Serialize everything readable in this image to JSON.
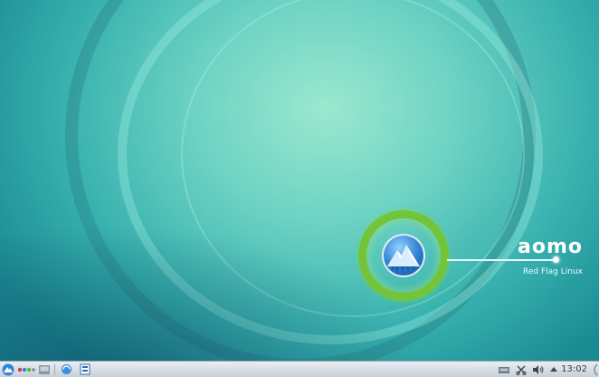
{
  "desktop": {
    "brand": {
      "name": "aomo",
      "subtitle": "Red Flag Linux"
    },
    "colors": {
      "ring_green": "#74c43a",
      "globe_blue": "#2c7ed0"
    }
  },
  "taskbar": {
    "launcher_icons": [
      "start-menu-icon",
      "pager-icon",
      "desktop-preview-icon",
      "browser-icon",
      "file-manager-icon"
    ],
    "tray_icons": [
      "network-icon",
      "clipboard-scissors-icon",
      "volume-icon",
      "tray-expand-arrow-icon"
    ],
    "clock": "13:02"
  }
}
